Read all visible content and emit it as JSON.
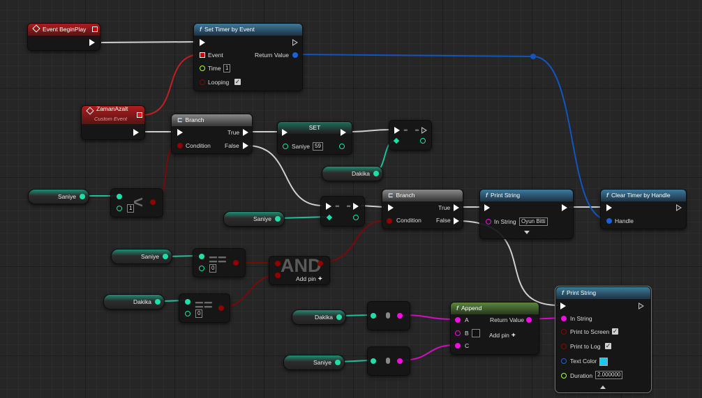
{
  "nodes": {
    "begin_play": {
      "title": "Event BeginPlay"
    },
    "set_timer": {
      "title": "Set Timer by Event",
      "pin_event": "Event",
      "pin_time": "Time",
      "time_value": "1",
      "pin_looping": "Looping",
      "looping_checked": true,
      "pin_return": "Return Value"
    },
    "zaman_azalt": {
      "title": "ZamanAzalt",
      "subtitle": "Custom Event"
    },
    "branch1": {
      "title": "Branch",
      "pin_condition": "Condition",
      "pin_true": "True",
      "pin_false": "False"
    },
    "set_saniye": {
      "title": "SET",
      "pin_saniye": "Saniye",
      "value": "59"
    },
    "var_dakika_1": {
      "label": "Dakika"
    },
    "var_saniye_1": {
      "label": "Saniye"
    },
    "less_op": {
      "symbol": "<",
      "value": "1"
    },
    "var_saniye_2": {
      "label": "Saniye"
    },
    "branch2": {
      "title": "Branch",
      "pin_condition": "Condition",
      "pin_true": "True",
      "pin_false": "False"
    },
    "print1": {
      "title": "Print String",
      "pin_in_string": "In String",
      "in_string_value": "Oyun Bitti"
    },
    "clear_timer": {
      "title": "Clear Timer by Handle",
      "pin_handle": "Handle"
    },
    "var_saniye_3": {
      "label": "Saniye"
    },
    "eq_op_1": {
      "symbol": "==",
      "value": "0"
    },
    "and_op": {
      "symbol": "AND",
      "add_pin": "Add pin"
    },
    "var_dakika_2": {
      "label": "Dakika"
    },
    "eq_op_2": {
      "symbol": "==",
      "value": "0"
    },
    "var_dakika_3": {
      "label": "Dakika"
    },
    "var_saniye_4": {
      "label": "Saniye"
    },
    "append": {
      "title": "Append",
      "pin_a": "A",
      "pin_b": "B",
      "pin_c": "C",
      "pin_return": "Return Value",
      "add_pin": "Add pin"
    },
    "print2": {
      "title": "Print String",
      "pin_in_string": "In String",
      "pin_print_screen": "Print to Screen",
      "pin_print_log": "Print to Log",
      "pin_text_color": "Text Color",
      "pin_duration": "Duration",
      "duration_value": "2.000000"
    }
  },
  "colors": {
    "exec": "#ffffff",
    "integer": "#1edfa8",
    "boolean": "#920101",
    "string": "#f00ee0",
    "struct_handle": "#0a5ad6",
    "delegate": "#e01a1a",
    "float": "#a4ff40",
    "linear_color": "#0a5ad6",
    "text_color_swatch": "#18c8f0"
  }
}
